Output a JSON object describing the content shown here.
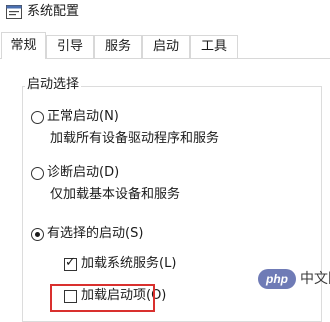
{
  "window": {
    "title": "系统配置",
    "icon": "msconfig-icon"
  },
  "tabs": [
    {
      "label": "常规",
      "active": true
    },
    {
      "label": "引导",
      "active": false
    },
    {
      "label": "服务",
      "active": false
    },
    {
      "label": "启动",
      "active": false
    },
    {
      "label": "工具",
      "active": false
    }
  ],
  "startup_selection": {
    "group_label": "启动选择",
    "normal": {
      "label": "正常启动(N)",
      "description": "加载所有设备驱动程序和服务",
      "selected": false
    },
    "diagnostic": {
      "label": "诊断启动(D)",
      "description": "仅加载基本设备和服务",
      "selected": false
    },
    "selective": {
      "label": "有选择的启动(S)",
      "selected": true,
      "load_system_services": {
        "label": "加载系统服务(L)",
        "checked": true
      },
      "load_startup_items": {
        "label": "加载启动项(O)",
        "checked": false
      }
    }
  },
  "highlight_color": "#d9302e",
  "watermark": {
    "logo": "php",
    "text": "中文网"
  }
}
